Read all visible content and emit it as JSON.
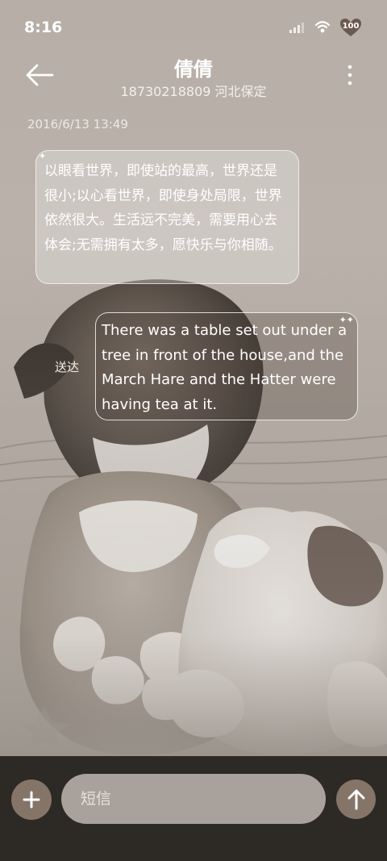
{
  "status_bar": {
    "time": "8:16",
    "battery_level": "100"
  },
  "header": {
    "contact_name": "倩倩",
    "contact_info": "18730218809 河北保定"
  },
  "conversation": {
    "timestamp": "2016/6/13 13:49",
    "received_message": "以眼看世界，即使站的最高，世界还是很小;以心看世界，即使身处局限，世界依然很大。生活远不完美，需要用心去体会;无需拥有太多，愿快乐与你相随。",
    "sent_message": "There was a table set out under a tree in front of the house,and the March Hare and the Hatter were having tea at it.",
    "delivery_status": "送达"
  },
  "composer": {
    "placeholder": "短信"
  },
  "icons": {
    "back": "arrow-left",
    "more": "vertical-ellipsis",
    "add": "plus",
    "send": "arrow-up",
    "signal": "cellular-signal",
    "wifi": "wifi",
    "battery": "heart-battery"
  },
  "colors": {
    "background": "#b7aea7",
    "bottom_bar": "#2d2925",
    "action_button": "#857468",
    "input_field": "#a9a19b"
  }
}
